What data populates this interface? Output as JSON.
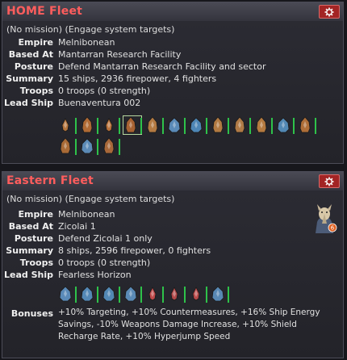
{
  "fleets": [
    {
      "title": "HOME Fleet",
      "mission": "(No mission) (Engage system targets)",
      "empire_label": "Empire",
      "empire": "Melnibonean",
      "based_label": "Based At",
      "based": "Mantarran Research Facility",
      "posture_label": "Posture",
      "posture": "Defend Mantarran Research Facility and sector",
      "summary_label": "Summary",
      "summary": "15 ships, 2936 firepower, 4 fighters",
      "troops_label": "Troops",
      "troops": "0 troops (0 strength)",
      "lead_label": "Lead Ship",
      "lead": "Buenaventura 002",
      "ships": [
        {
          "kind": "fighter",
          "color": "#b4743c"
        },
        {
          "kind": "cruiser",
          "color": "#b06a34"
        },
        {
          "kind": "fighter",
          "color": "#b8703a"
        },
        {
          "kind": "cruiser",
          "color": "#a86232"
        },
        {
          "kind": "cruiser",
          "color": "#b47a42"
        },
        {
          "kind": "frigate",
          "color": "#5a8ab8"
        },
        {
          "kind": "frigate",
          "color": "#4e86b6"
        },
        {
          "kind": "cruiser",
          "color": "#b27a42"
        },
        {
          "kind": "cruiser",
          "color": "#b07a46"
        },
        {
          "kind": "cruiser",
          "color": "#b57a40"
        },
        {
          "kind": "frigate",
          "color": "#5288b4"
        },
        {
          "kind": "cruiser",
          "color": "#ae6e38"
        },
        {
          "kind": "cruiser",
          "color": "#a86a36"
        },
        {
          "kind": "frigate",
          "color": "#5c8ab6"
        },
        {
          "kind": "cruiser",
          "color": "#a8683a"
        }
      ]
    },
    {
      "title": "Eastern Fleet",
      "mission": "(No mission) (Engage system targets)",
      "empire_label": "Empire",
      "empire": "Melnibonean",
      "based_label": "Based At",
      "based": "Zicolai 1",
      "posture_label": "Posture",
      "posture": "Defend Zicolai 1 only",
      "summary_label": "Summary",
      "summary": "8 ships, 2596 firepower, 0 fighters",
      "troops_label": "Troops",
      "troops": "0 troops (0 strength)",
      "lead_label": "Lead Ship",
      "lead": "Fearless Horizon",
      "ships": [
        {
          "kind": "frigate",
          "color": "#5a8ab8"
        },
        {
          "kind": "frigate",
          "color": "#5488b6"
        },
        {
          "kind": "frigate",
          "color": "#5288b4"
        },
        {
          "kind": "frigate",
          "color": "#5a8ab6"
        },
        {
          "kind": "fighter",
          "color": "#c04a4a"
        },
        {
          "kind": "fighter",
          "color": "#b04848"
        },
        {
          "kind": "fighter",
          "color": "#b84a4a"
        },
        {
          "kind": "frigate",
          "color": "#5888b4"
        }
      ],
      "bonuses_label": "Bonuses",
      "bonuses": "+10% Targeting, +10% Countermeasures, +16% Ship Energy Savings, -10% Weapons Damage Increase, +10% Shield Recharge Rate, +10% Hyperjump Speed"
    }
  ],
  "icons": {
    "settings": "gear-icon",
    "portrait": "leader-portrait"
  },
  "colors": {
    "title": "#ff5d5d",
    "gear_bg": "#a32424",
    "health": "#2ec24a"
  }
}
